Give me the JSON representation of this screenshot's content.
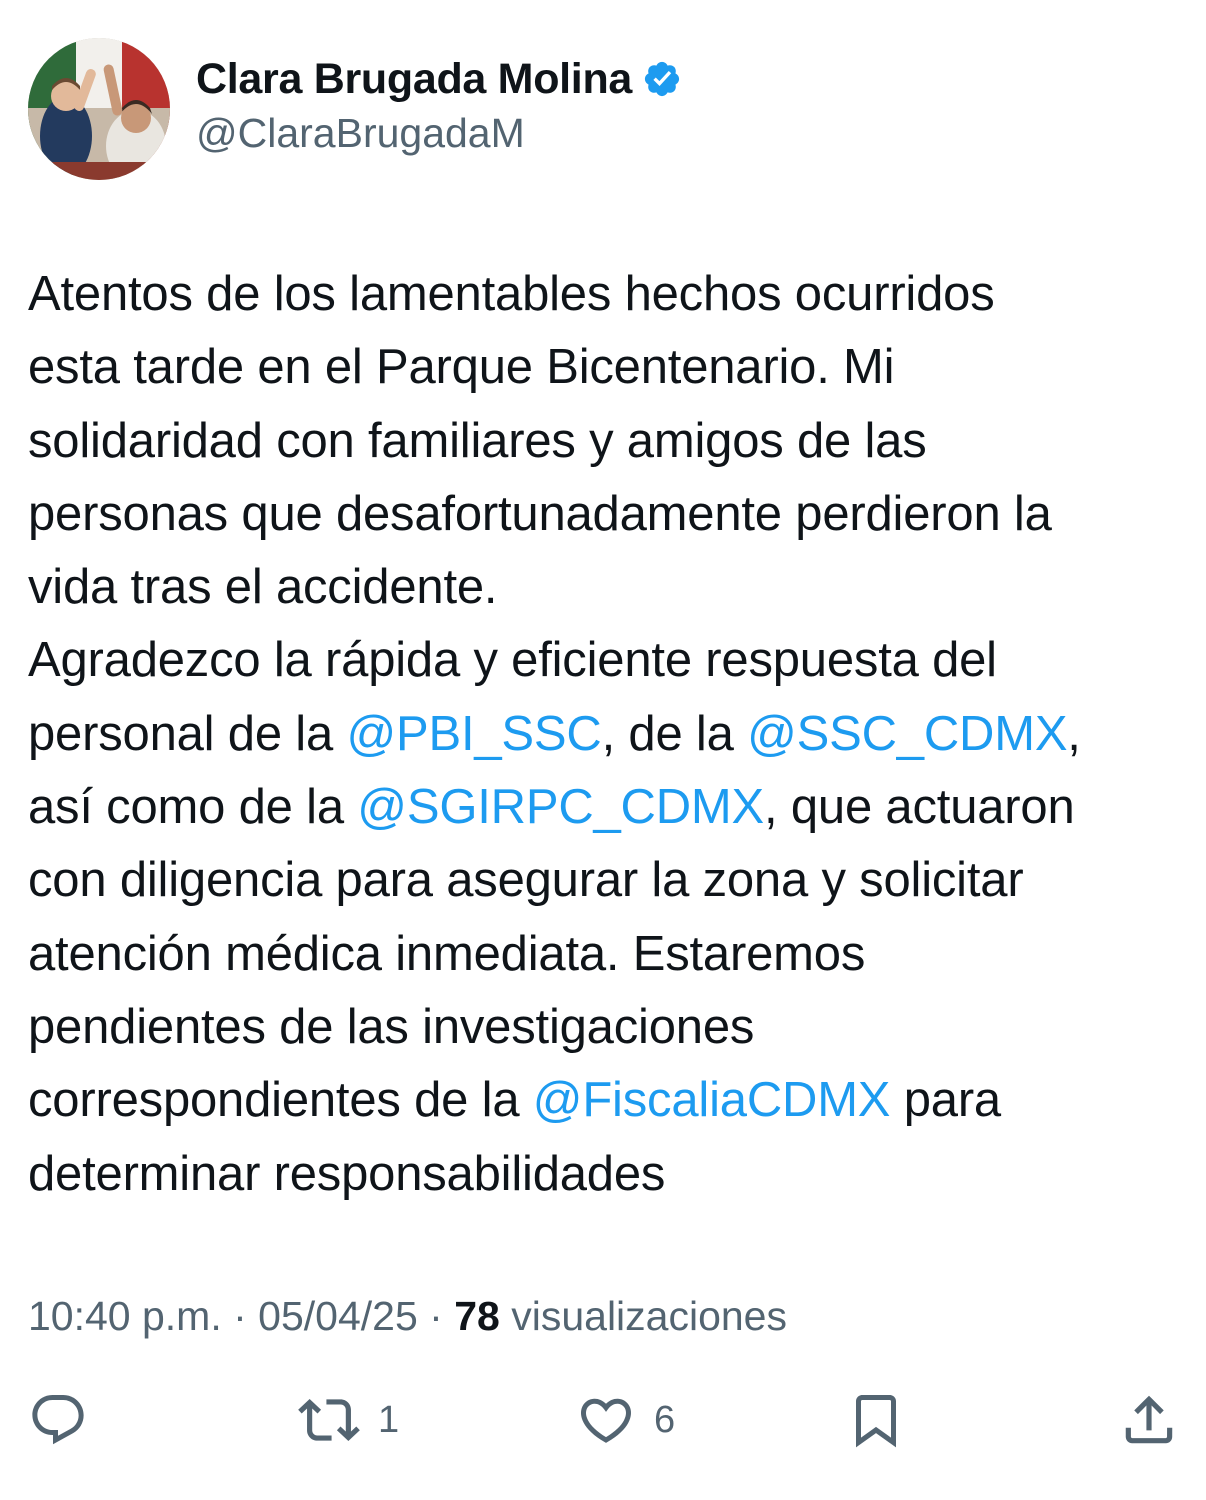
{
  "author": {
    "display_name": "Clara Brugada Molina",
    "handle": "@ClaraBrugadaM",
    "verified": true,
    "verified_color": "#1d9bf0",
    "avatar_icon": "profile-photo"
  },
  "tweet": {
    "lines": [
      [
        {
          "t": "Atentos de los lamentables hechos ocurridos"
        }
      ],
      [
        {
          "t": "esta tarde en el Parque Bicentenario. Mi"
        }
      ],
      [
        {
          "t": "solidaridad con familiares y amigos de las"
        }
      ],
      [
        {
          "t": "personas que desafortunadamente perdieron la"
        }
      ],
      [
        {
          "t": "vida tras el accidente."
        }
      ],
      [
        {
          "t": "Agradezco la rápida y eficiente respuesta del"
        }
      ],
      [
        {
          "t": "personal de la "
        },
        {
          "t": "@PBI_SSC",
          "m": true
        },
        {
          "t": ", de la "
        },
        {
          "t": "@SSC_CDMX",
          "m": true
        },
        {
          "t": ","
        }
      ],
      [
        {
          "t": "así como de la "
        },
        {
          "t": "@SGIRPC_CDMX",
          "m": true
        },
        {
          "t": ", que actuaron"
        }
      ],
      [
        {
          "t": "con diligencia para asegurar la zona y solicitar"
        }
      ],
      [
        {
          "t": "atención médica inmediata. Estaremos"
        }
      ],
      [
        {
          "t": "pendientes de las investigaciones"
        }
      ],
      [
        {
          "t": "correspondientes de la "
        },
        {
          "t": "@FiscaliaCDMX",
          "m": true
        },
        {
          "t": " para"
        }
      ],
      [
        {
          "t": "determinar responsabilidades"
        }
      ]
    ],
    "mention_color": "#1d9bf0"
  },
  "meta": {
    "time": "10:40 p.m.",
    "separator": " · ",
    "date": "05/04/25",
    "views_count": "78",
    "views_label": "visualizaciones"
  },
  "actions": {
    "reply": {
      "icon": "reply-icon"
    },
    "retweet": {
      "icon": "retweet-icon",
      "count": "1"
    },
    "like": {
      "icon": "heart-icon",
      "count": "6"
    },
    "bookmark": {
      "icon": "bookmark-icon"
    },
    "share": {
      "icon": "share-icon"
    }
  },
  "colors": {
    "text": "#0f1419",
    "secondary": "#536471",
    "accent": "#1d9bf0"
  }
}
